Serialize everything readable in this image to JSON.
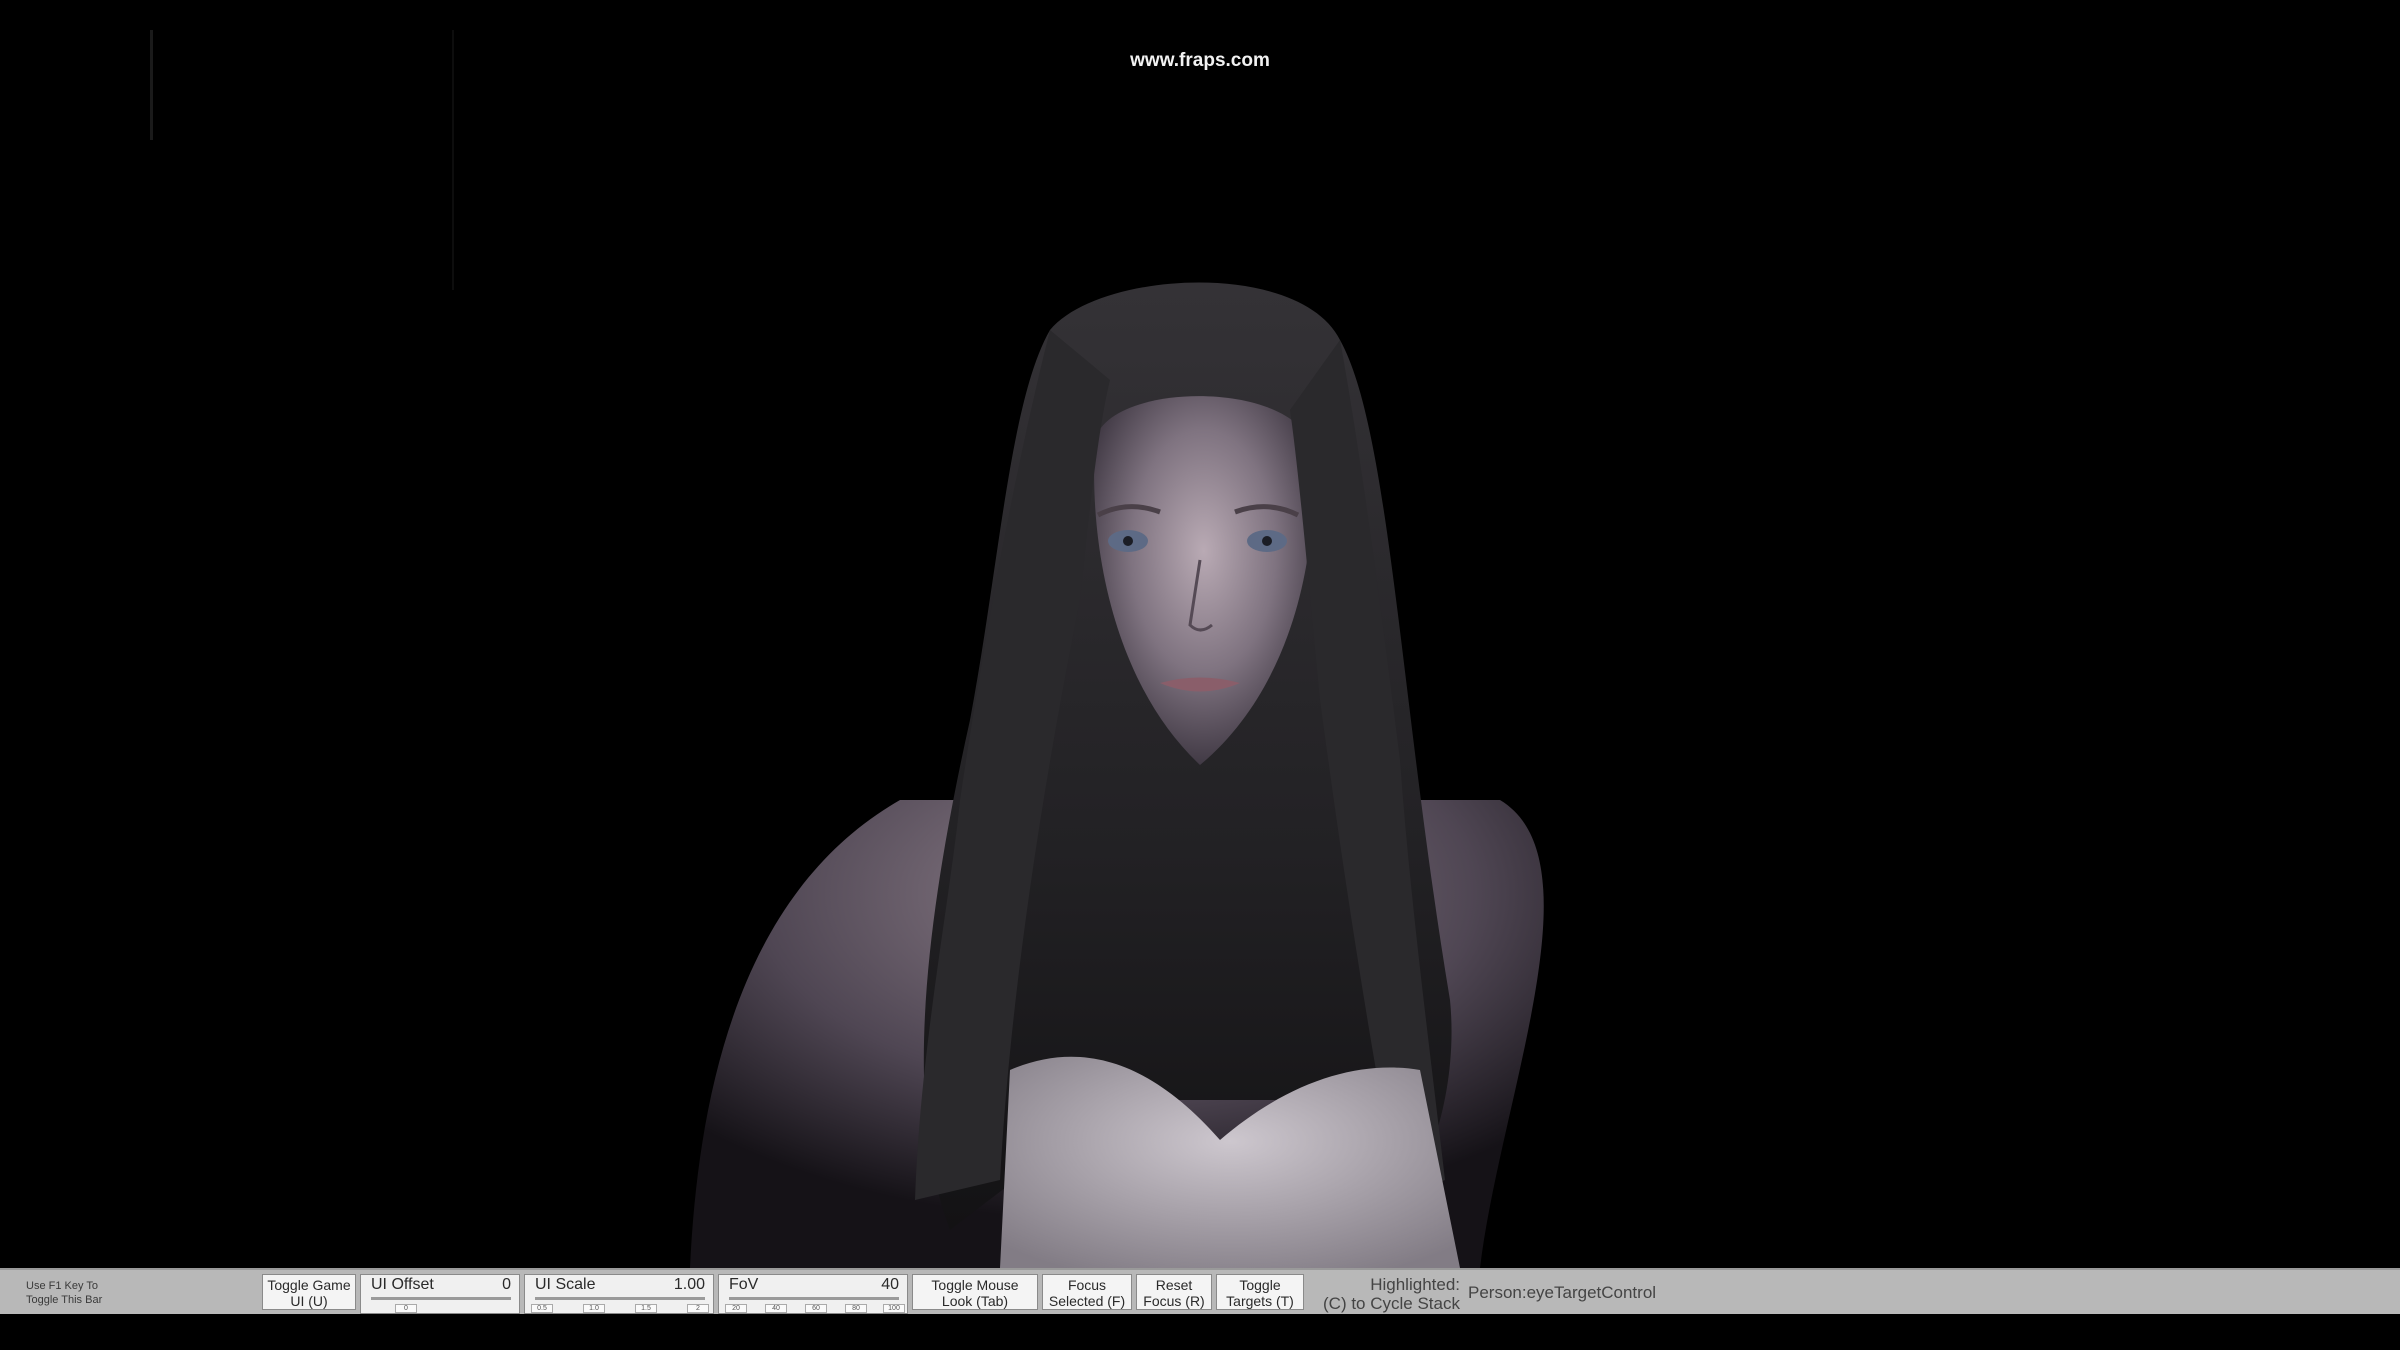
{
  "watermark": "www.fraps.com",
  "scene": {
    "subject": "character-model"
  },
  "toolbar": {
    "hint": [
      "Use F1 Key To",
      "Toggle This Bar"
    ],
    "toggle_game_ui": [
      "Toggle Game",
      "UI (U)"
    ],
    "ui_offset": {
      "label": "UI Offset",
      "value": "0",
      "ticks": [
        "0"
      ],
      "fraction": 0.5
    },
    "ui_scale": {
      "label": "UI Scale",
      "value": "1.00",
      "ticks": [
        "0.5",
        "1.0",
        "1.5",
        "2"
      ],
      "fraction": 0.33
    },
    "fov": {
      "label": "FoV",
      "value": "40",
      "ticks": [
        "20",
        "40",
        "60",
        "80",
        "100"
      ],
      "fraction": 0.25
    },
    "toggle_mouse_look": [
      "Toggle Mouse",
      "Look (Tab)"
    ],
    "focus_selected": [
      "Focus",
      "Selected (F)"
    ],
    "reset_focus": [
      "Reset",
      "Focus (R)"
    ],
    "toggle_targets": [
      "Toggle",
      "Targets (T)"
    ],
    "highlighted_label": [
      "Highlighted:",
      "(C) to Cycle Stack"
    ],
    "highlighted_value": "Person:eyeTargetControl"
  },
  "colors": {
    "toolbar_bg": "#b8b8b8",
    "button_bg": "#f4f4f4",
    "scene_bg": "#000000"
  }
}
